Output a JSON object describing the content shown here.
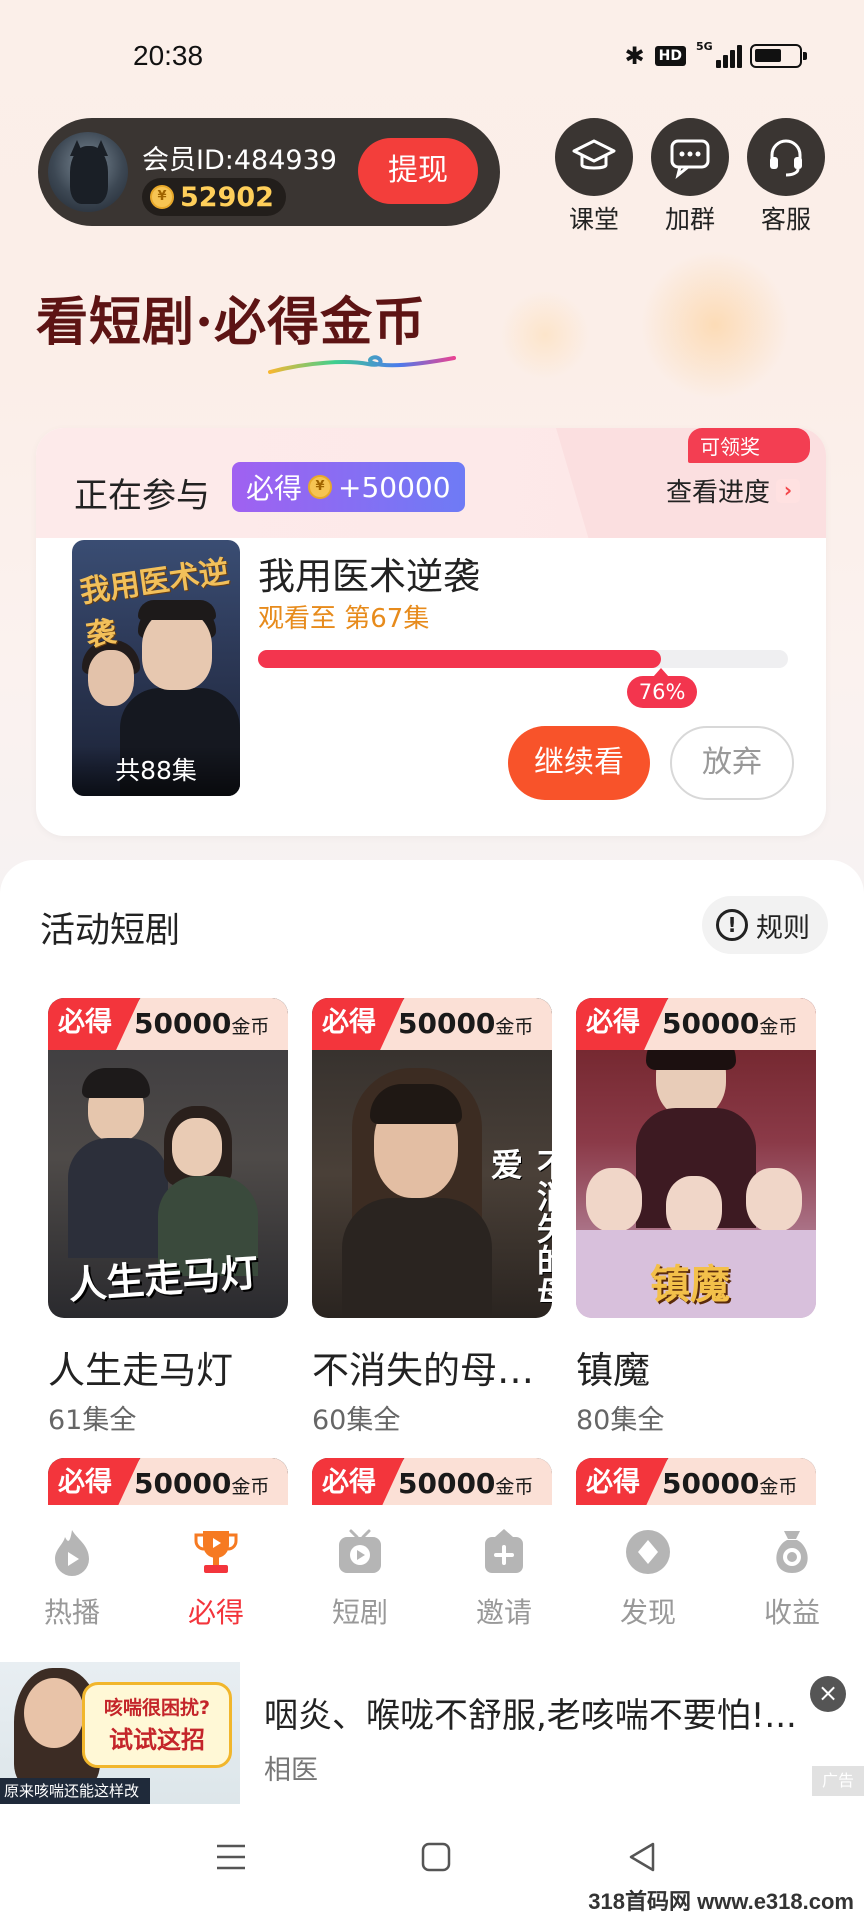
{
  "status_bar": {
    "time": "20:38",
    "network": "5G",
    "hd": "HD"
  },
  "member": {
    "id_label": "会员ID:484939",
    "coins": "52902",
    "withdraw_label": "提现"
  },
  "top_actions": [
    {
      "label": "课堂",
      "icon": "graduation-cap-icon"
    },
    {
      "label": "加群",
      "icon": "chat-group-icon"
    },
    {
      "label": "客服",
      "icon": "headset-icon"
    }
  ],
  "headline": "看短剧·必得金币",
  "participating": {
    "title": "正在参与",
    "reward_prefix": "必得",
    "reward_amount": "+50000",
    "claim_badge": "可领奖",
    "view_progress": "查看进度",
    "poster_title": "我用医术逆袭",
    "episode_total": "共88集",
    "drama_title": "我用医术逆袭",
    "watched_text": "观看至 第67集",
    "progress_percent": 76,
    "progress_label": "76%",
    "continue_label": "继续看",
    "abandon_label": "放弃"
  },
  "activity": {
    "title": "活动短剧",
    "rules_label": "规则",
    "cards": [
      {
        "badge_tag": "必得",
        "reward": "50000",
        "unit": "金币",
        "poster_title": "人生走马灯",
        "name": "人生走马灯",
        "episodes": "61集全"
      },
      {
        "badge_tag": "必得",
        "reward": "50000",
        "unit": "金币",
        "poster_title": "不消失的母爱",
        "name": "不消失的母…",
        "episodes": "60集全"
      },
      {
        "badge_tag": "必得",
        "reward": "50000",
        "unit": "金币",
        "poster_title": "镇魔",
        "name": "镇魔",
        "episodes": "80集全"
      }
    ],
    "more_cards": [
      {
        "badge_tag": "必得",
        "reward": "50000",
        "unit": "金币"
      },
      {
        "badge_tag": "必得",
        "reward": "50000",
        "unit": "金币"
      },
      {
        "badge_tag": "必得",
        "reward": "50000",
        "unit": "金币"
      }
    ]
  },
  "tabs": [
    {
      "label": "热播",
      "icon": "flame-play-icon",
      "active": false
    },
    {
      "label": "必得",
      "icon": "trophy-icon",
      "active": true
    },
    {
      "label": "短剧",
      "icon": "tv-play-icon",
      "active": false
    },
    {
      "label": "邀请",
      "icon": "invite-icon",
      "active": false
    },
    {
      "label": "发现",
      "icon": "discover-icon",
      "active": false
    },
    {
      "label": "收益",
      "icon": "money-bag-icon",
      "active": false
    }
  ],
  "ad": {
    "image_bubble_line1": "咳喘很困扰?",
    "image_bubble_line2": "试试这招",
    "image_caption": "原来咳喘还能这样改善",
    "title": "咽炎、喉咙不舒服,老咳喘不要怕!...",
    "source": "相医",
    "label": "广告",
    "close": "×"
  },
  "watermark": "318首码网 www.e318.com",
  "colors": {
    "accent_red": "#f3353c",
    "orange": "#f8532a",
    "gold": "#ffcf5a",
    "purple": "#a061f1"
  }
}
